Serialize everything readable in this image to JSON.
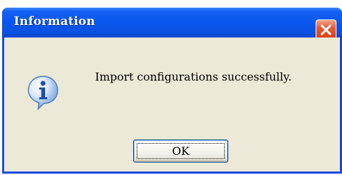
{
  "dialog": {
    "title": "Information",
    "message": "Import configurations successfully.",
    "ok_label": "OK",
    "icon": "information-icon",
    "close_icon": "close-icon"
  },
  "colors": {
    "titlebar": "#0a50e0",
    "client": "#ece9d8",
    "close_button": "#e55b35",
    "info_icon": "#2d6fd0"
  }
}
